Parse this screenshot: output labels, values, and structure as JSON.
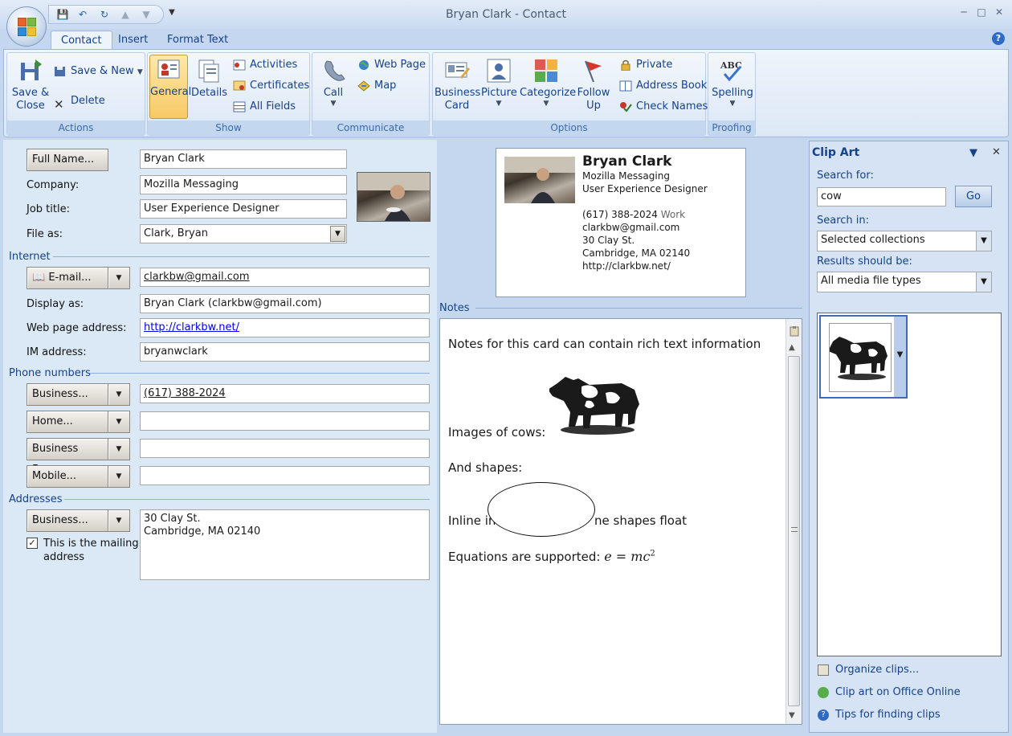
{
  "window": {
    "title": "Bryan Clark - Contact"
  },
  "tabs": [
    {
      "label": "Contact"
    },
    {
      "label": "Insert"
    },
    {
      "label": "Format Text"
    }
  ],
  "ribbon": {
    "actions": {
      "label": "Actions",
      "save_close": "Save &\nClose",
      "save_new": "Save & New",
      "delete": "Delete"
    },
    "show": {
      "label": "Show",
      "general": "General",
      "details": "Details",
      "activities": "Activities",
      "certificates": "Certificates",
      "all_fields": "All Fields"
    },
    "communicate": {
      "label": "Communicate",
      "call": "Call",
      "web_page": "Web Page",
      "map": "Map"
    },
    "options": {
      "label": "Options",
      "business_card": "Business\nCard",
      "picture": "Picture",
      "categorize": "Categorize",
      "follow_up": "Follow\nUp",
      "private": "Private",
      "address_book": "Address Book",
      "check_names": "Check Names"
    },
    "proofing": {
      "label": "Proofing",
      "spelling": "Spelling"
    }
  },
  "form": {
    "full_name_button": "Full Name...",
    "full_name": "Bryan Clark",
    "company_label": "Company:",
    "company": "Mozilla Messaging",
    "job_title_label": "Job title:",
    "job_title": "User Experience Designer",
    "file_as_label": "File as:",
    "file_as": "Clark, Bryan",
    "internet_section": "Internet",
    "email_button": "E-mail...",
    "email": "clarkbw@gmail.com",
    "display_as_label": "Display as:",
    "display_as": "Bryan Clark (clarkbw@gmail.com)",
    "web_label": "Web page address:",
    "web": "http://clarkbw.net/",
    "im_label": "IM address:",
    "im": "bryanwclark",
    "phone_section": "Phone numbers",
    "phones": [
      {
        "label": "Business...",
        "value": "(617) 388-2024"
      },
      {
        "label": "Home...",
        "value": ""
      },
      {
        "label": "Business Fax...",
        "value": ""
      },
      {
        "label": "Mobile...",
        "value": ""
      }
    ],
    "addresses_section": "Addresses",
    "address_button": "Business...",
    "address_line1": "30 Clay St.",
    "address_line2": "Cambridge, MA 02140",
    "mailing_checkbox": "This is the mailing",
    "mailing_checkbox_2": "address",
    "mailing_checked": true
  },
  "business_card": {
    "name": "Bryan Clark",
    "company": "Mozilla Messaging",
    "title": "User Experience Designer",
    "phone": "(617) 388-2024",
    "phone_type": "Work",
    "email": "clarkbw@gmail.com",
    "street": "30 Clay St.",
    "city": "Cambridge, MA 02140",
    "web": "http://clarkbw.net/"
  },
  "notes": {
    "label": "Notes",
    "line1": "Notes for this card can contain rich text information",
    "line2": "Images of cows:",
    "line3": "And shapes:",
    "line4a": "Inline in",
    "line4b": "ne shapes float",
    "line5": "Equations are supported:",
    "equation_lhs": "e",
    "equation_eq": "=",
    "equation_rhs": "mc",
    "equation_exp": "2"
  },
  "clipart": {
    "title": "Clip Art",
    "search_for_label": "Search for:",
    "search_value": "cow",
    "go": "Go",
    "search_in_label": "Search in:",
    "search_in": "Selected collections",
    "results_label": "Results should be:",
    "results": "All media file types",
    "organize": "Organize clips...",
    "online": "Clip art on Office Online",
    "tips": "Tips for finding clips"
  },
  "colors": {
    "accent": "#15428b",
    "ribbon": "#dce8f6",
    "selected": "#f8c866"
  },
  "icons": [
    "office-orb-icon",
    "save-icon",
    "undo-icon",
    "redo-icon",
    "up-icon",
    "down-icon",
    "floppy-icon",
    "delete-icon",
    "general-icon",
    "details-icon",
    "phone-icon",
    "globe-icon",
    "map-icon",
    "business-card-icon",
    "picture-icon",
    "categorize-icon",
    "flag-icon",
    "lock-icon",
    "address-book-icon",
    "check-names-icon",
    "spelling-icon",
    "cow-clipart-icon"
  ]
}
